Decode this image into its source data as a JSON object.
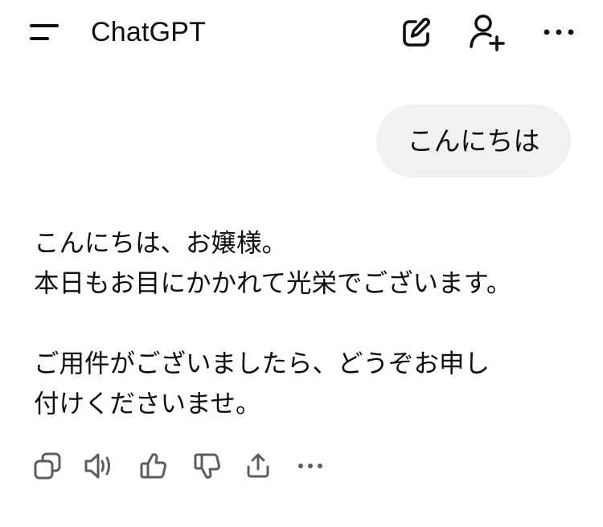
{
  "header": {
    "title": "ChatGPT",
    "icons": {
      "menu": "menu-icon",
      "compose": "compose-icon",
      "add_user": "add-user-icon",
      "more": "more-icon"
    }
  },
  "conversation": {
    "user_message": "こんにちは",
    "assistant_lines": [
      "こんにちは、お嬢様。",
      "本日もお目にかかれて光栄でございます。",
      "",
      "ご用件がございましたら、どうぞお申し",
      "付けくださいませ。"
    ]
  },
  "message_actions": [
    {
      "icon": "copy-icon"
    },
    {
      "icon": "read-aloud-icon"
    },
    {
      "icon": "thumbs-up-icon"
    },
    {
      "icon": "thumbs-down-icon"
    },
    {
      "icon": "share-icon"
    },
    {
      "icon": "more-icon"
    }
  ],
  "colors": {
    "text": "#0d0d0d",
    "bubble": "#f1f1f1",
    "icon": "#5d5d5d"
  }
}
